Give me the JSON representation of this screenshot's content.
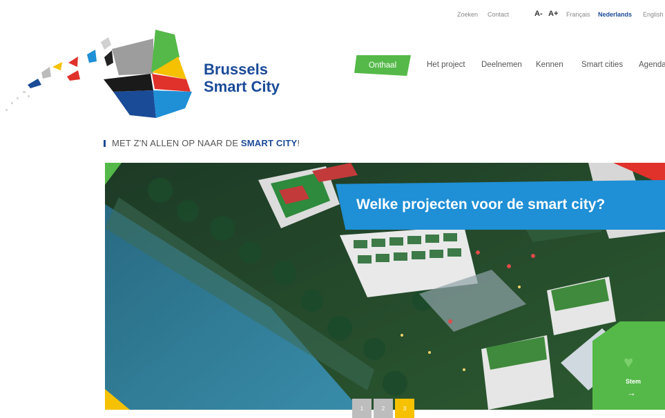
{
  "utility_bar": {
    "search": "Zoeken",
    "contact": "Contact",
    "font_smaller": "A-",
    "font_larger": "A+",
    "languages": [
      {
        "label": "Français",
        "active": false
      },
      {
        "label": "Nederlands",
        "active": true
      },
      {
        "label": "English",
        "active": false
      }
    ]
  },
  "brand": {
    "line1": "Brussels",
    "line2": "Smart City"
  },
  "nav": {
    "items": [
      {
        "label": "Onthaal",
        "active": true
      },
      {
        "label": "Het project",
        "active": false
      },
      {
        "label": "Deelnemen",
        "active": false
      },
      {
        "label": "Kennen",
        "active": false
      },
      {
        "label": "Smart cities",
        "active": false
      },
      {
        "label": "Agenda",
        "active": false
      }
    ]
  },
  "tagline": {
    "prefix": "MET Z'N ALLEN OP NAAR DE",
    "highlight": "SMART CITY",
    "suffix": "!"
  },
  "hero": {
    "headline": "Welke projecten voor de smart city?",
    "vote": {
      "icon": "heart-icon",
      "label": "Stem",
      "arrow_icon": "arrow-right-icon"
    }
  },
  "pager": {
    "pages": [
      "1",
      "2",
      "3"
    ],
    "active_page": "3"
  },
  "colors": {
    "brand_blue": "#1a4b97",
    "green": "#54b948",
    "sky_blue": "#1f8fd6",
    "red": "#e0312b",
    "yellow": "#f6c100"
  }
}
